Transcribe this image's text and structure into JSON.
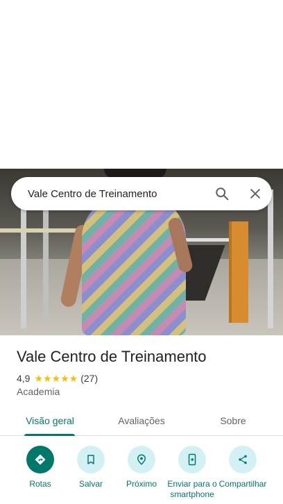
{
  "search": {
    "query": "Vale Centro de Treinamento"
  },
  "place": {
    "name": "Vale Centro de Treinamento",
    "rating": "4,9",
    "stars": "★★★★★",
    "reviews": "(27)",
    "category": "Academia"
  },
  "tabs": [
    {
      "label": "Visão geral",
      "active": true
    },
    {
      "label": "Avaliações",
      "active": false
    },
    {
      "label": "Sobre",
      "active": false
    }
  ],
  "actions": [
    {
      "label": "Rotas",
      "icon": "directions-icon"
    },
    {
      "label": "Salvar",
      "icon": "bookmark-icon"
    },
    {
      "label": "Próximo",
      "icon": "nearby-icon"
    },
    {
      "label": "Enviar para o smartphone",
      "icon": "send-to-phone-icon"
    },
    {
      "label": "Compartilhar",
      "icon": "share-icon"
    }
  ],
  "colors": {
    "accent": "#00796b",
    "action_bg": "#d3f1f5",
    "star": "#fbbc04"
  }
}
